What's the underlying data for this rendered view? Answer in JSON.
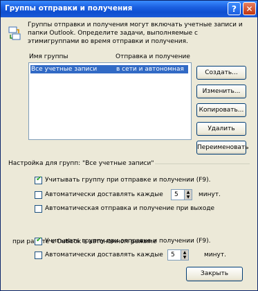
{
  "window": {
    "title": "Группы отправки и получения",
    "help_label": "?",
    "close_label": "✕"
  },
  "intro": {
    "text": "Группы отправки и получения могут включать учетные записи и папки Outlook. Определите задачи, выполняемые с этимигруппами во время отправки и получения."
  },
  "list": {
    "col_name": "Имя группы",
    "col_status": "Отправка и получение",
    "rows": [
      {
        "name": "Все учетные записи",
        "status": "в сети и автономная"
      }
    ]
  },
  "buttons": {
    "create": "Создать...",
    "edit": "Изменить...",
    "copy": "Копировать...",
    "delete": "Удалить",
    "rename": "Переименовать"
  },
  "online": {
    "legend": "Настройка для групп: \"Все учетные записи\"",
    "include_label": "Учитывать группу при отправке и получении (F9).",
    "include_checked": true,
    "schedule_label": "Автоматически доставлять каждые",
    "schedule_checked": false,
    "schedule_value": "5",
    "schedule_unit": "минут.",
    "exit_label": "Автоматическая отправка и получение при выходе",
    "exit_checked": false
  },
  "offline": {
    "legend": "при работе с Outlook в автономном режиме",
    "include_label": "Учитывать группу при отправке и получении (F9).",
    "include_checked": true,
    "schedule_label": "Автоматически доставлять каждые",
    "schedule_checked": false,
    "schedule_value": "5",
    "schedule_unit": "минут."
  },
  "footer": {
    "close": "Закрыть"
  }
}
